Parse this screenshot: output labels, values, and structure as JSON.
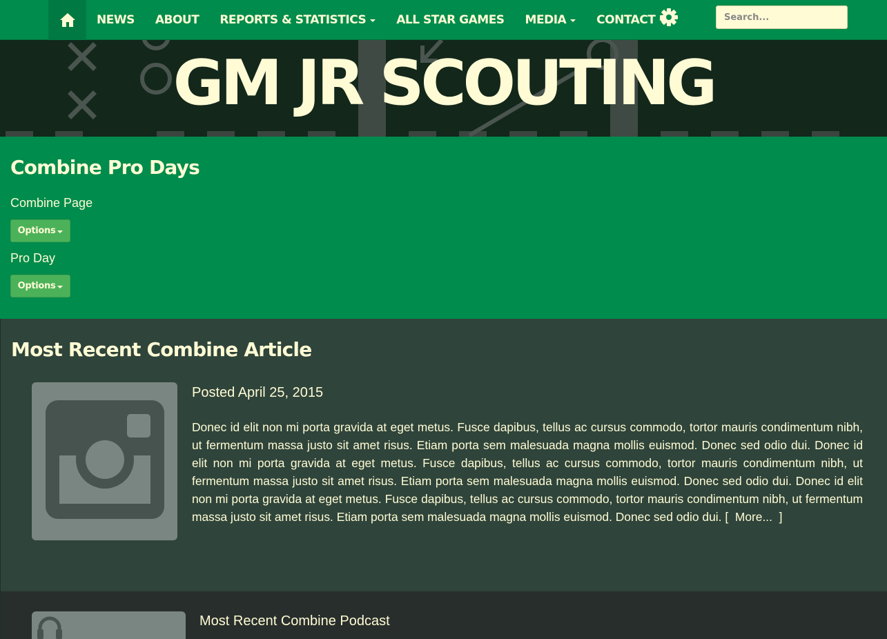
{
  "nav": {
    "home_icon": "home-icon",
    "items": [
      {
        "label": "NEWS",
        "dropdown": false
      },
      {
        "label": "ABOUT",
        "dropdown": false
      },
      {
        "label": "REPORTS & STATISTICS",
        "dropdown": true
      },
      {
        "label": "ALL STAR GAMES",
        "dropdown": false
      },
      {
        "label": "MEDIA",
        "dropdown": true
      },
      {
        "label": "CONTACT",
        "dropdown": true
      }
    ],
    "settings_icon": "gear-icon",
    "search_placeholder": "Search..."
  },
  "banner": {
    "title": "GM JR SCOUTING"
  },
  "combine": {
    "heading": "Combine Pro Days",
    "combine_page_label": "Combine Page",
    "pro_day_label": "Pro Day",
    "options_label": "Options"
  },
  "article": {
    "heading": "Most Recent Combine Article",
    "thumbnail_icon": "instagram-icon",
    "posted": "Posted April 25, 2015",
    "body": "Donec id elit non mi porta gravida at eget metus. Fusce dapibus, tellus ac cursus commodo, tortor mauris condimentum nibh, ut fermentum massa justo sit amet risus. Etiam porta sem malesuada magna mollis euismod. Donec sed odio dui. Donec id elit non mi porta gravida at eget metus. Fusce dapibus, tellus ac cursus commodo, tortor mauris condimentum nibh, ut fermentum massa justo sit amet risus. Etiam porta sem malesuada magna mollis euismod. Donec sed odio dui. Donec id elit non mi porta gravida at eget metus. Fusce dapibus, tellus ac cursus commodo, tortor mauris condimentum nibh, ut fermentum massa justo sit amet risus. Etiam porta sem malesuada magna mollis euismod. Donec sed odio dui.",
    "more_prefix": "[",
    "more_label": "More...",
    "more_suffix": "]"
  },
  "podcast": {
    "heading": "Most Recent Combine Podcast",
    "thumbnail_icon": "headphones-icon"
  },
  "colors": {
    "brand_green": "#008c4c",
    "cream": "#fffbd5",
    "banner_dark": "#13271b",
    "article_bg": "#2f443a",
    "podcast_bg": "#282e2b",
    "button_green": "#4cb25a"
  }
}
